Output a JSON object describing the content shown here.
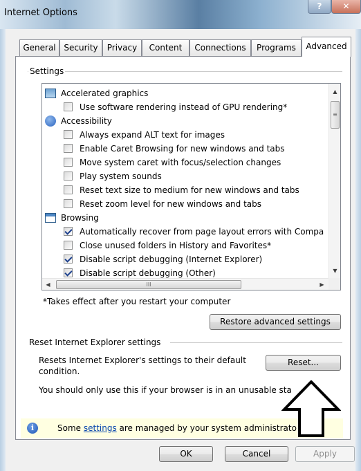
{
  "window": {
    "title": "Internet Options",
    "help_label": "?",
    "close_label": "✕"
  },
  "tabs": [
    {
      "label": "General",
      "active": false
    },
    {
      "label": "Security",
      "active": false
    },
    {
      "label": "Privacy",
      "active": false
    },
    {
      "label": "Content",
      "active": false
    },
    {
      "label": "Connections",
      "active": false
    },
    {
      "label": "Programs",
      "active": false
    },
    {
      "label": "Advanced",
      "active": true
    }
  ],
  "settings": {
    "group_label": "Settings",
    "items": [
      {
        "type": "category",
        "icon": "monitor-icon",
        "label": "Accelerated graphics"
      },
      {
        "type": "checkbox",
        "checked": false,
        "label": "Use software rendering instead of GPU rendering*"
      },
      {
        "type": "category",
        "icon": "accessibility-icon",
        "label": "Accessibility"
      },
      {
        "type": "checkbox",
        "checked": false,
        "label": "Always expand ALT text for images"
      },
      {
        "type": "checkbox",
        "checked": false,
        "label": "Enable Caret Browsing for new windows and tabs"
      },
      {
        "type": "checkbox",
        "checked": false,
        "label": "Move system caret with focus/selection changes"
      },
      {
        "type": "checkbox",
        "checked": false,
        "label": "Play system sounds"
      },
      {
        "type": "checkbox",
        "checked": false,
        "label": "Reset text size to medium for new windows and tabs"
      },
      {
        "type": "checkbox",
        "checked": false,
        "label": "Reset zoom level for new windows and tabs"
      },
      {
        "type": "category",
        "icon": "browser-window-icon",
        "label": "Browsing"
      },
      {
        "type": "checkbox",
        "checked": true,
        "label": "Automatically recover from page layout errors with Compa"
      },
      {
        "type": "checkbox",
        "checked": false,
        "label": "Close unused folders in History and Favorites*"
      },
      {
        "type": "checkbox",
        "checked": true,
        "label": "Disable script debugging (Internet Explorer)"
      },
      {
        "type": "checkbox",
        "checked": true,
        "label": "Disable script debugging (Other)"
      }
    ],
    "footnote": "*Takes effect after you restart your computer",
    "restore_button": "Restore advanced settings",
    "scroll_up": "▲",
    "scroll_down": "▼",
    "scroll_left": "◀",
    "scroll_right": "▶",
    "grip_vertical": "≡",
    "grip_horizontal": "III"
  },
  "reset": {
    "group_label": "Reset Internet Explorer settings",
    "description": "Resets Internet Explorer's settings to their default condition.",
    "description_line1": "Resets Internet Explorer's settings to their default",
    "description_line2": "condition.",
    "button": "Reset...",
    "warning": "You should only use this if your browser is in an unusable sta"
  },
  "infobar": {
    "icon": "info-icon",
    "icon_glyph": "i",
    "prefix": "Some ",
    "link": "settings",
    "suffix": " are managed by your system administrato"
  },
  "footer": {
    "ok": "OK",
    "cancel": "Cancel",
    "apply": "Apply"
  }
}
